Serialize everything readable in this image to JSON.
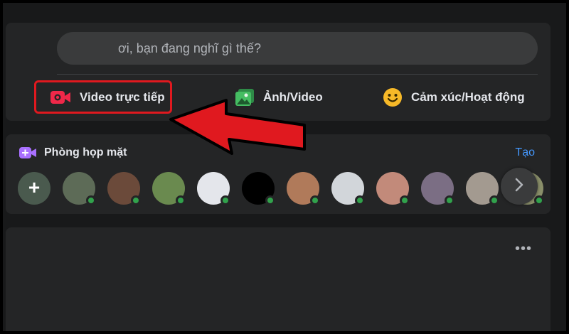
{
  "composer": {
    "placeholder": "ơi, bạn đang nghĩ gì thế?",
    "actions": [
      {
        "label": "Video trực tiếp",
        "icon": "live-video-icon",
        "color": "#f02849"
      },
      {
        "label": "Ảnh/Video",
        "icon": "photo-icon",
        "color": "#45bd62"
      },
      {
        "label": "Cảm xúc/Hoạt động",
        "icon": "feeling-icon",
        "color": "#f7b928"
      }
    ]
  },
  "rooms": {
    "title": "Phòng họp mặt",
    "create_label": "Tạo",
    "accent": "#a970ff",
    "avatars": [
      {
        "icon": "add-icon",
        "online": false,
        "color": "#4a5a4e"
      },
      {
        "online": true,
        "color": "#5d6b57"
      },
      {
        "online": true,
        "color": "#6b4a3a"
      },
      {
        "online": true,
        "color": "#6a8a4f"
      },
      {
        "online": true,
        "color": "#e4e6eb"
      },
      {
        "online": true,
        "color": "#000000"
      },
      {
        "online": true,
        "color": "#b07a5a"
      },
      {
        "online": true,
        "color": "#d2d6da"
      },
      {
        "online": true,
        "color": "#c28a7a"
      },
      {
        "online": true,
        "color": "#7b6e84"
      },
      {
        "online": true,
        "color": "#a39a90"
      },
      {
        "online": true,
        "color": "#8a8f6a"
      }
    ]
  },
  "post": {
    "more_label": "•••"
  },
  "annotation": {
    "color": "#e0191f"
  }
}
